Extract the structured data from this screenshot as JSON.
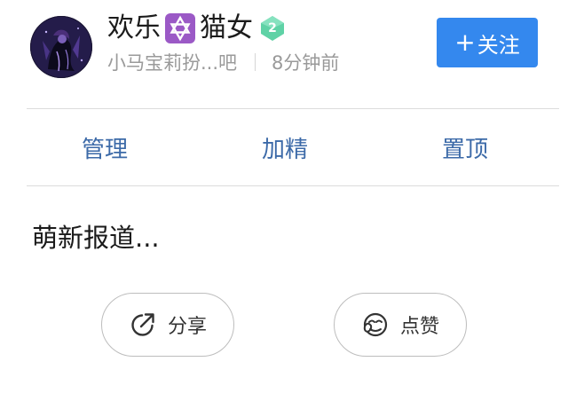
{
  "post": {
    "author": {
      "name_part1": "欢乐",
      "name_part2": "猫女",
      "emblem_icon": "star-of-david-emoji",
      "level": "2",
      "forum": "小马宝莉扮...吧",
      "time": "8分钟前"
    },
    "follow_button": "关注",
    "admin_actions": [
      "管理",
      "加精",
      "置顶"
    ],
    "content": "萌新报道...",
    "actions": {
      "share": "分享",
      "like": "点赞"
    }
  },
  "colors": {
    "accent": "#3488ee",
    "admin_link": "#3c6aa8",
    "badge": "#5fd2a6",
    "emblem_bg": "#9b59c6"
  }
}
